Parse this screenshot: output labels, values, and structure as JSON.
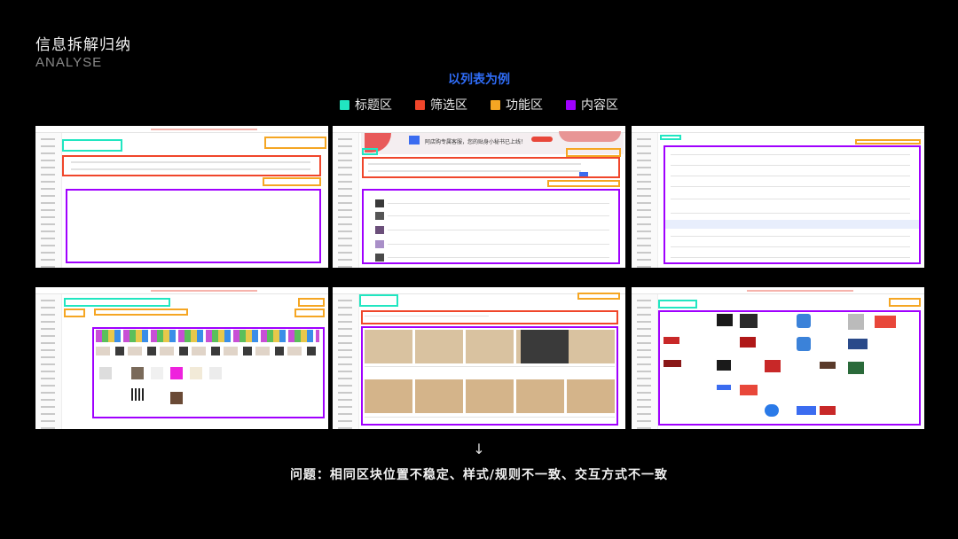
{
  "header": {
    "title_cn": "信息拆解归纳",
    "title_en": "ANALYSE"
  },
  "subtitle": "以列表为例",
  "legend": [
    {
      "label": "标题区",
      "color": "#21e6c1"
    },
    {
      "label": "筛选区",
      "color": "#f0462b"
    },
    {
      "label": "功能区",
      "color": "#f5a623"
    },
    {
      "label": "内容区",
      "color": "#a000ff"
    }
  ],
  "screens": {
    "s2_banner": "阿店购专属客服，您的贴身小秘书已上线！"
  },
  "arrow": "↓",
  "problem": "问题：相同区块位置不稳定、样式/规则不一致、交互方式不一致"
}
